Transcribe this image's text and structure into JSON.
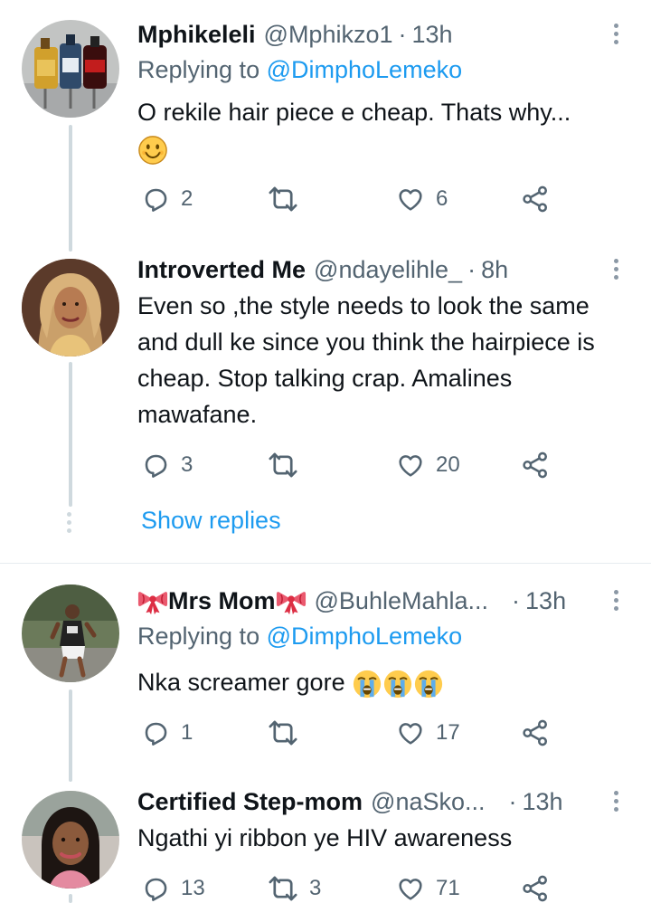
{
  "tweets": [
    {
      "name": "Mphikeleli",
      "handle": "@Mphikzo1",
      "separator": "·",
      "time": "13h",
      "replying_prefix": "Replying to ",
      "replying_to": "@DimphoLemeko",
      "text": "O rekile hair piece e cheap. Thats why...",
      "emoji": "slightly-smiling-face",
      "replies": "2",
      "retweets": "",
      "likes": "6"
    },
    {
      "name": "Introverted Me",
      "handle": "@ndayelihle_",
      "separator": "·",
      "time": "8h",
      "text": "Even so ,the style needs to look the same and dull ke since you think the hairpiece is cheap. Stop talking crap. Amalines mawafane.",
      "replies": "3",
      "retweets": "",
      "likes": "20"
    },
    {
      "name_emoji": "ribbon",
      "name": "Mrs Mom",
      "handle": "@BuhleMahla...",
      "separator": "·",
      "time": "13h",
      "replying_prefix": "Replying to ",
      "replying_to": "@DimphoLemeko",
      "text": "Nka screamer gore",
      "emoji": "loudly-crying-face x3",
      "replies": "1",
      "retweets": "",
      "likes": "17"
    },
    {
      "name": "Certified Step-mom",
      "handle": "@naSko...",
      "separator": "·",
      "time": "13h",
      "text": "Ngathi yi ribbon ye HIV awareness",
      "replies": "13",
      "retweets": "3",
      "likes": "71"
    }
  ],
  "show_replies_label": "Show replies",
  "icons": {
    "reply": "reply-icon",
    "retweet": "retweet-icon",
    "like": "like-icon",
    "share": "share-icon",
    "more": "more-icon"
  },
  "colors": {
    "link": "#1d9bf0",
    "secondary": "#536471",
    "primary": "#0f1419",
    "thread_line": "#cfd9de"
  }
}
